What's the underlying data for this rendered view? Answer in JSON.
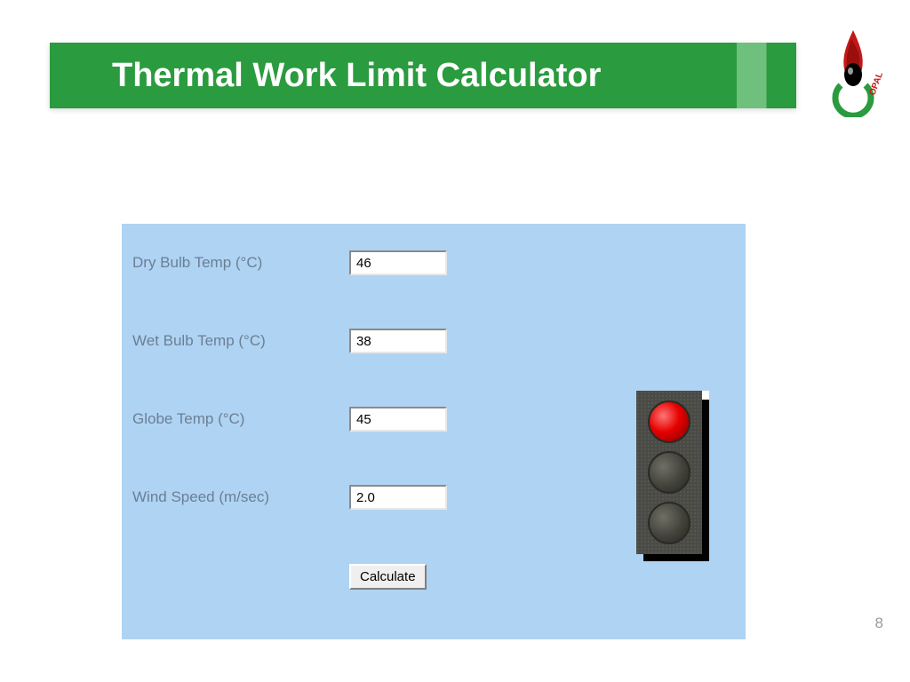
{
  "header": {
    "title": "Thermal Work Limit Calculator"
  },
  "logo": {
    "text": "OPAL",
    "accent_color": "#2a9b3e",
    "flame_color": "#c41818"
  },
  "form": {
    "fields": [
      {
        "label": "Dry Bulb Temp (°C)",
        "value": "46"
      },
      {
        "label": "Wet Bulb Temp (°C)",
        "value": "38"
      },
      {
        "label": "Globe Temp (°C)",
        "value": "45"
      },
      {
        "label": "Wind Speed (m/sec)",
        "value": "2.0"
      }
    ],
    "calculate_label": "Calculate"
  },
  "traffic_light": {
    "state": "red"
  },
  "page_number": "8"
}
